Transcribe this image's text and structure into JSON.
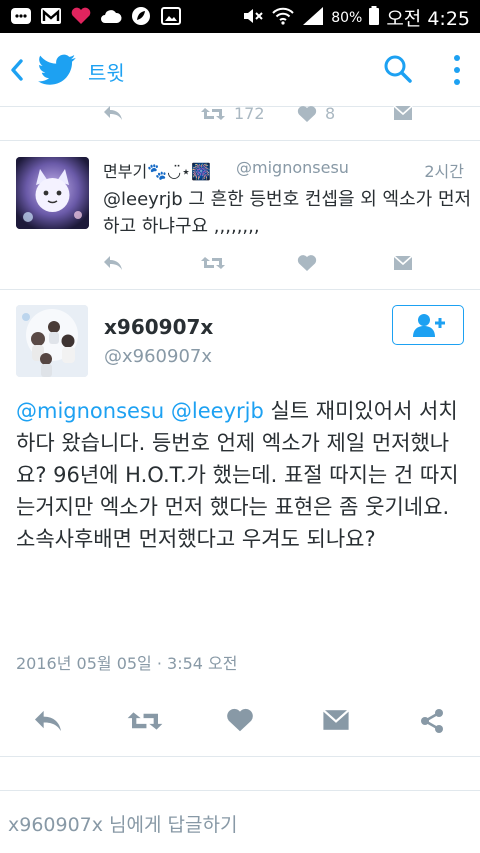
{
  "status_bar": {
    "battery": "80%",
    "time": "오전 4:25"
  },
  "header": {
    "title": "트윗"
  },
  "prev_tweet": {
    "retweet_count": "172",
    "like_count": "8"
  },
  "reply_tweet": {
    "name": "면부기🐾◡̈⋆🎆",
    "handle": "@mignonsesu",
    "time": "2시간",
    "text": "@leeyrjb 그 흔한 등번호 컨셉을 외 엑소가 먼저하고 하냐구요 ,,,,,,,,"
  },
  "main_tweet": {
    "name": "x960907x",
    "handle": "@x960907x",
    "mention1": "@mignonsesu",
    "mention2": "@leeyrjb",
    "body": " 실트 재미있어서 서치하다 왔습니다. 등번호 언제 엑소가 제일 먼저했나요? 96년에 H.O.T.가 했는데. 표절 따지는 건 따지는거지만 엑소가 먼저 했다는 표현은 좀 웃기네요. 소속사후배면 먼저했다고 우겨도 되나요?",
    "date": "2016년 05월 05일 · 3:54 오전"
  },
  "reply_box": {
    "placeholder": "x960907x 님에게 답글하기"
  },
  "colors": {
    "accent": "#1da1f2",
    "icon_gray": "#aab8c2",
    "icon_dark": "#8899a6"
  }
}
